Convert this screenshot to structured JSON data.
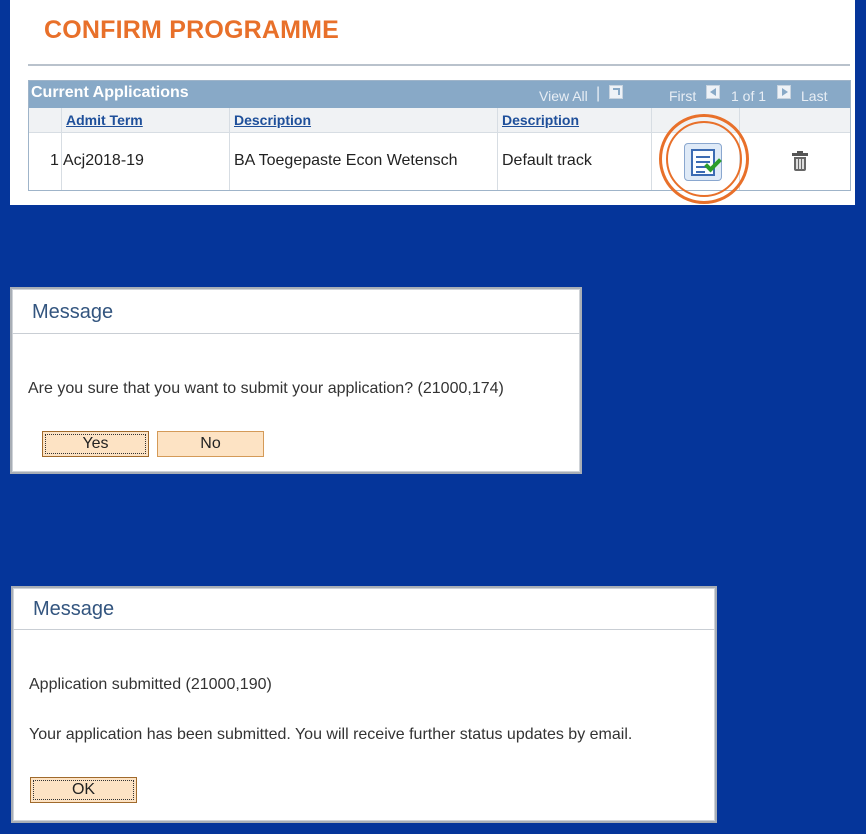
{
  "panel1": {
    "title": "CONFIRM PROGRAMME",
    "grid": {
      "caption": "Current Applications",
      "view_all": "View All",
      "nav_first": "First",
      "nav_count": "1 of 1",
      "nav_last": "Last",
      "columns": [
        "Admit Term",
        "Description",
        "Description"
      ],
      "rows": [
        {
          "index": "1",
          "admit_term": "Acj2018-19",
          "description": "BA Toegepaste Econ Wetensch",
          "track": "Default track"
        }
      ]
    },
    "colors": {
      "title": "#e8702a",
      "grid_header": "#88a9c7",
      "highlight": "#e8702a"
    }
  },
  "dialog1": {
    "title": "Message",
    "text": "Are you sure that you want to submit your application? (21000,174)",
    "yes_label": "Yes",
    "no_label": "No"
  },
  "dialog2": {
    "title": "Message",
    "text1": "Application submitted (21000,190)",
    "text2": "Your application has been submitted. You will receive further status updates by email.",
    "ok_label": "OK"
  },
  "background_color": "#05359a"
}
